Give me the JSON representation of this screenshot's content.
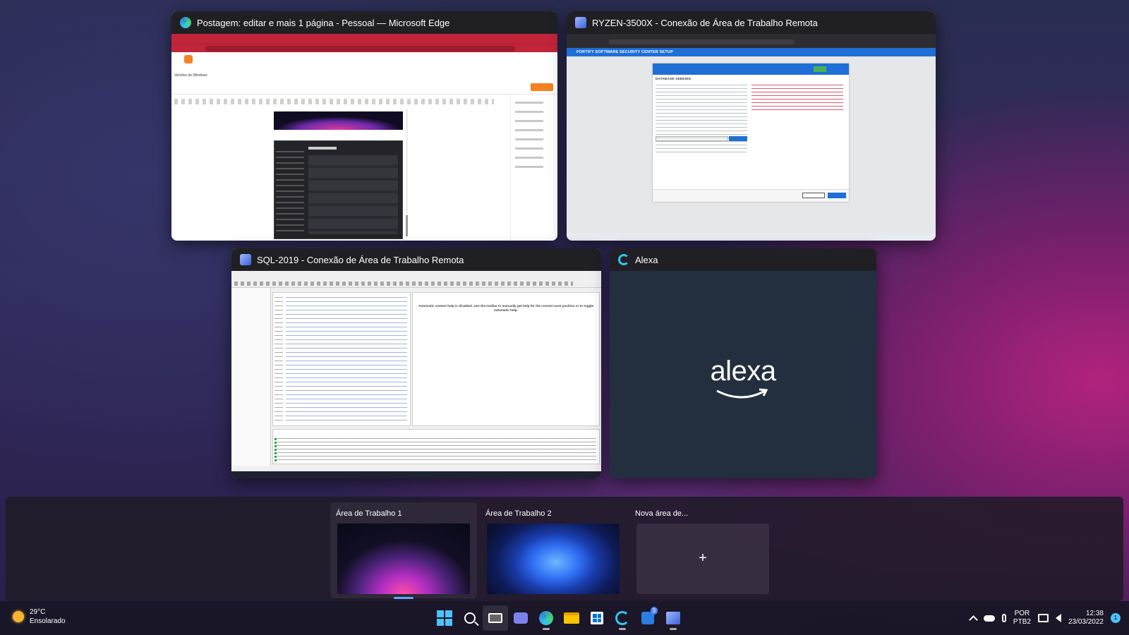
{
  "windows": {
    "edge": {
      "title": "Postagem: editar e mais 1 página - Pessoal — Microsoft Edge",
      "post_title": "Versões do Windows"
    },
    "ryzen": {
      "title": "RYZEN-3500X - Conexão de Área de Trabalho Remota",
      "app_header": "FORTIFY SOFTWARE SECURITY CENTER SETUP",
      "section": "DATABASE SEEDING"
    },
    "sql": {
      "title": "SQL-2019 - Conexão de Área de Trabalho Remota",
      "help_text": "Automatic context help is disabled. Use the toolbar to manually get help for the current caret position or to toggle automatic help."
    },
    "alexa": {
      "title": "Alexa",
      "logo_text": "alexa"
    }
  },
  "desktops": {
    "items": [
      {
        "label": "Área de Trabalho 1"
      },
      {
        "label": "Área de Trabalho 2"
      },
      {
        "label": "Nova área de..."
      }
    ],
    "new_symbol": "+"
  },
  "taskbar": {
    "weather_temp": "29°C",
    "weather_desc": "Ensolarado",
    "todo_badge": "3",
    "lang_line1": "POR",
    "lang_line2": "PTB2",
    "time": "12:38",
    "date": "23/03/2022",
    "notifications": "1"
  },
  "colors": {
    "edge_accent": "#c0253a",
    "fortify_blue": "#1f6fd6",
    "alexa_bg": "#232f3e",
    "alexa_ring": "#31c4f3",
    "blogger_orange": "#f58220"
  },
  "icons": [
    "edge-icon",
    "rdp-icon",
    "alexa-icon",
    "windows-start-icon",
    "search-icon",
    "task-view-icon",
    "teams-chat-icon",
    "file-explorer-icon",
    "store-icon",
    "todo-icon",
    "sun-icon",
    "chevron-up-icon",
    "onedrive-icon",
    "microphone-icon",
    "network-icon",
    "volume-icon"
  ]
}
